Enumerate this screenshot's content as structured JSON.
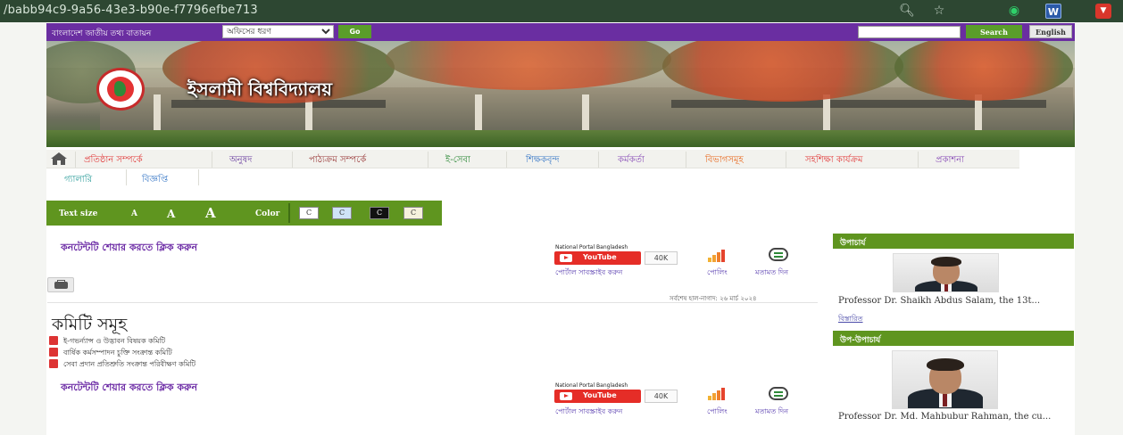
{
  "browser": {
    "url": "/babb94c9-9a56-43e3-b90e-f7796efbe713",
    "icons": [
      "zoom-icon",
      "bookmark-star-icon",
      "grammarly-extension-icon",
      "word-extension-icon",
      "pocket-extension-icon"
    ],
    "ext_word_label": "W"
  },
  "topbar": {
    "portal_text": "বাংলাদেশ জাতীয় তথ্য বাতায়ন",
    "office_select": "অফিসের ধরণ",
    "go_label": "Go",
    "search_label": "Search",
    "english_label": "English"
  },
  "banner": {
    "site_title": "ইসলামী বিশ্ববিদ্যালয়"
  },
  "menu": {
    "row1": [
      {
        "label": "প্রতিষ্ঠান সম্পর্কে",
        "color": "#e13c3c"
      },
      {
        "label": "অনুষদ",
        "color": "#6b3fa0"
      },
      {
        "label": "পাঠ্যক্রম সম্পর্কে",
        "color": "#9a3b3b"
      },
      {
        "label": "ই-সেবা",
        "color": "#2f8a39"
      },
      {
        "label": "শিক্ষকবৃন্দ",
        "color": "#3a79c7"
      },
      {
        "label": "কর্মকর্তা",
        "color": "#8a4fb8"
      },
      {
        "label": "বিভাগসমূহ",
        "color": "#e86a20"
      },
      {
        "label": "সহশিক্ষা কার্যক্রম",
        "color": "#e13c3c"
      },
      {
        "label": "প্রকাশনা",
        "color": "#8a4fb8"
      }
    ],
    "row2": [
      {
        "label": "গ্যালারি",
        "color": "#2b9c9a"
      },
      {
        "label": "বিজ্ঞপ্তি",
        "color": "#3a79c7"
      }
    ]
  },
  "textsize": {
    "label": "Text size",
    "sizes": [
      "A",
      "A",
      "A"
    ],
    "color_label": "Color",
    "color_options": [
      {
        "label": "C",
        "bg": "#ffffff",
        "fg": "#333333"
      },
      {
        "label": "C",
        "bg": "#cfe3f7",
        "fg": "#333333"
      },
      {
        "label": "C",
        "bg": "#111111",
        "fg": "#ffffff"
      },
      {
        "label": "C",
        "bg": "#f6f1dc",
        "fg": "#333333"
      }
    ]
  },
  "share": {
    "link_text": "কনটেন্টটি শেয়ার করতে ক্লিক করুন",
    "portal_name": "National Portal Bangladesh",
    "youtube_label": "YouTube",
    "youtube_count": "40K",
    "portal_connect": "পোর্টাল সাবস্ক্রাইব করুন",
    "polling": "পোলিং",
    "feedback": "মতামত দিন"
  },
  "last_updated": "সর্বশেষ হাল-নাগাদ: ২৬ মার্চ ২০২৪",
  "committee": {
    "title": "কমিটি সমূহ",
    "items": [
      "ই-গভর্ন্যান্স ও উদ্ভাবন বিষয়ক কমিটি",
      "বার্ষিক কর্মসম্পাদন চুক্তি সংক্রান্ত কমিটি",
      "সেবা প্রদান প্রতিশ্রুতি সংক্রান্ত পরিবীক্ষণ কমিটি"
    ]
  },
  "sidebar": {
    "vc_heading": "উপাচার্য",
    "vc_text": "Professor Dr. Shaikh Abdus Salam, the 13t...",
    "vc_details": "বিস্তারিত",
    "pvc_heading": "উপ-উপাচার্য",
    "pvc_text": "Professor Dr. Md. Mahbubur Rahman, the cu..."
  },
  "colors": {
    "topbar_purple": "#6a2ea1",
    "accent_green": "#5f951f",
    "share_link_purple": "#6b2aa5"
  }
}
